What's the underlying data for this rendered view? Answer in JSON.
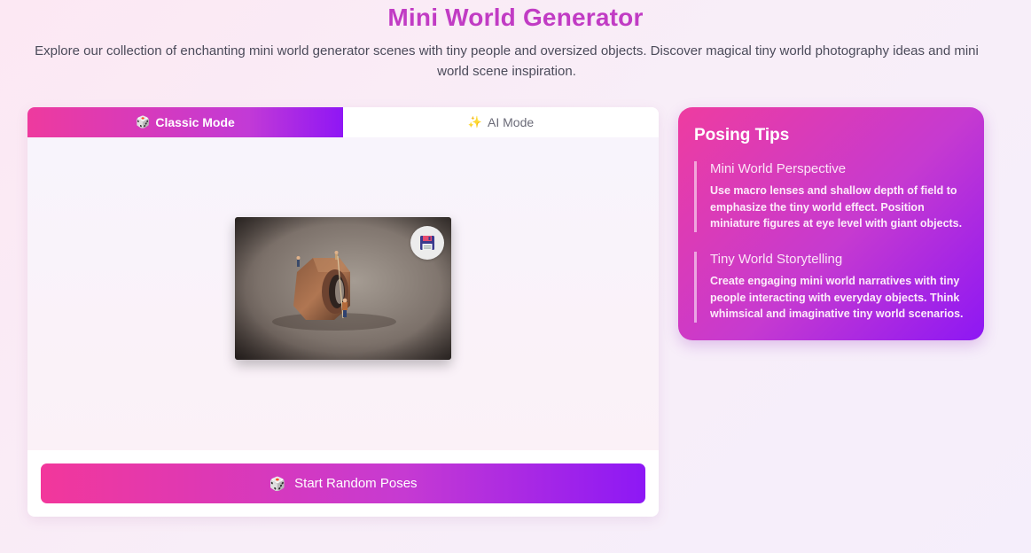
{
  "header": {
    "title": "Mini World Generator",
    "subtitle": "Explore our collection of enchanting mini world generator scenes with tiny people and oversized objects. Discover magical tiny world photography ideas and mini world scene inspiration."
  },
  "generator": {
    "tabs": [
      {
        "emoji": "🎲",
        "label": "Classic Mode",
        "active": true
      },
      {
        "emoji": "✨",
        "label": "AI Mode",
        "active": false
      }
    ],
    "image": {
      "subject": "miniature figures on a giant hex nut"
    },
    "save_icon": "floppy-disk-icon",
    "start_button": {
      "emoji": "🎲",
      "label": "Start Random Poses"
    }
  },
  "tips": {
    "title": "Posing Tips",
    "items": [
      {
        "title": "Mini World Perspective",
        "text": "Use macro lenses and shallow depth of field to emphasize the tiny world effect. Position miniature figures at eye level with giant objects."
      },
      {
        "title": "Tiny World Storytelling",
        "text": "Create engaging mini world narratives with tiny people interacting with everyday objects. Think whimsical and imaginative tiny world scenarios."
      }
    ]
  },
  "colors": {
    "title": "#c13cc4",
    "gradient_start": "#ee3a9e",
    "gradient_end": "#8f16f5"
  }
}
